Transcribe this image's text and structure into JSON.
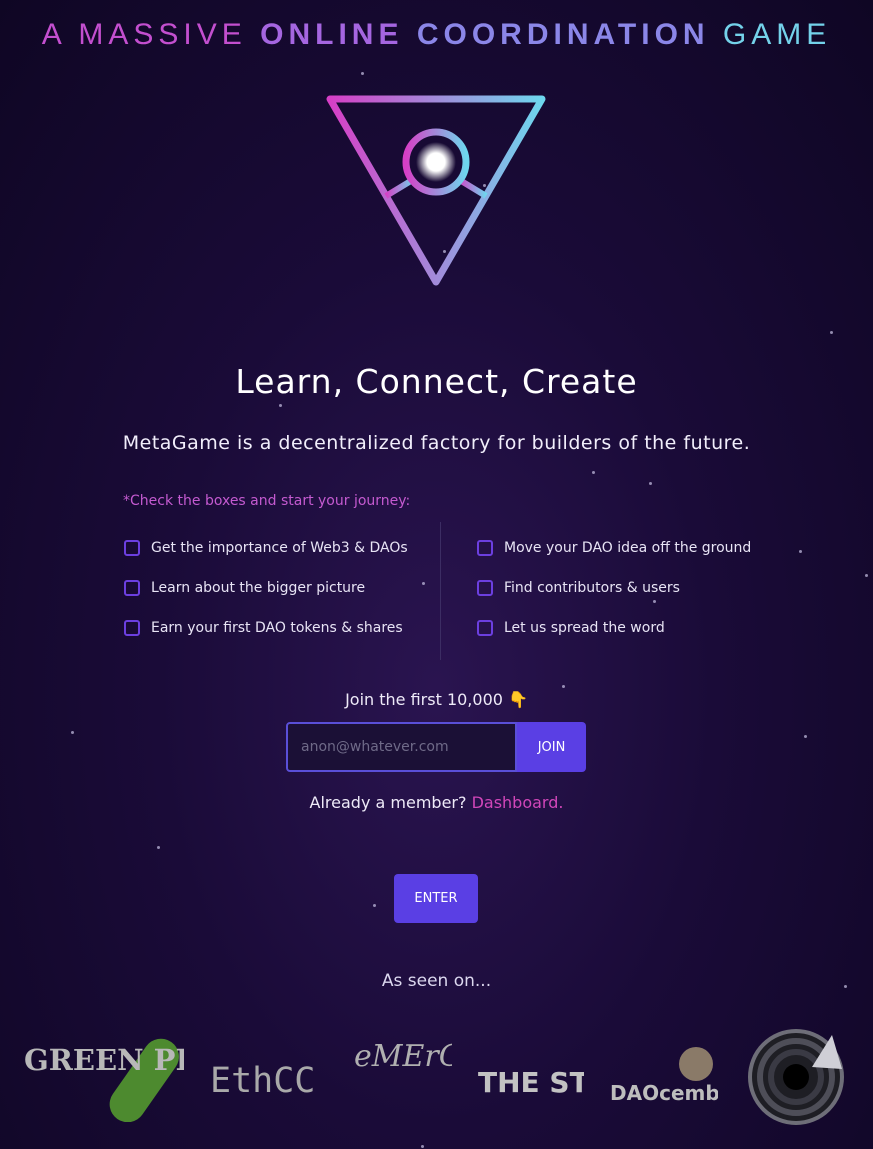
{
  "tagline": {
    "part1": "A MASSIVE",
    "part2": "ONLINE",
    "part3": "COORDINATION",
    "part4": "GAME"
  },
  "logo_icon": "triangle-eye-logo-icon",
  "hero": {
    "title": "Learn, Connect, Create",
    "subtitle": "MetaGame is a decentralized factory for builders of the future."
  },
  "journey": {
    "prompt": "*Check the boxes and start your journey:",
    "left": [
      "Get the importance of Web3 & DAOs",
      "Learn about the bigger picture",
      "Earn your first DAO tokens & shares"
    ],
    "right": [
      "Move your DAO idea off the ground",
      "Find contributors & users",
      "Let us spread the word"
    ]
  },
  "signup": {
    "label": "Join the first 10,000",
    "emoji": "👇",
    "placeholder": "anon@whatever.com",
    "join_label": "JOIN"
  },
  "member": {
    "prefix": "Already a member?",
    "link": "Dashboard."
  },
  "enter_label": "ENTER",
  "seen_on": {
    "label": "As seen on...",
    "partners": [
      "GREEN PILL",
      "EthCC",
      "eMErGe",
      "THE STOA",
      "DAOcember",
      "partner-spiral-logo-icon"
    ]
  },
  "colors": {
    "accent": "#5a3fe4",
    "pink": "#d146b9",
    "background": "#1a0b38"
  }
}
